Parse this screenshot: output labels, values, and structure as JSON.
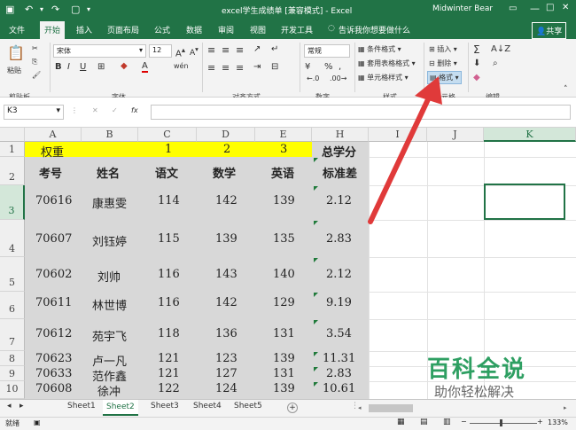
{
  "window": {
    "doc_title": "excel学生成绩单 [兼容模式] - Excel",
    "user": "Midwinter Bear",
    "minimize": "—",
    "restore": "□",
    "close": "✕"
  },
  "tabs": [
    "文件",
    "开始",
    "插入",
    "页面布局",
    "公式",
    "数据",
    "审阅",
    "视图",
    "开发工具"
  ],
  "tell_me": "告诉我你想要做什么",
  "share": "共享",
  "ribbon": {
    "paste": "粘贴",
    "clipboard": "剪贴板",
    "font_name": "宋体",
    "font_size": "12",
    "bold": "B",
    "italic": "I",
    "underline": "U",
    "font_color_glyph": "A",
    "font_group": "字体",
    "wrap": "wén",
    "align_group": "对齐方式",
    "num_format": "常规",
    "percent": "%",
    "comma": ",",
    "number_group": "数字",
    "cond_format": "条件格式",
    "table_format": "套用表格格式",
    "cell_style": "单元格样式",
    "style_group": "样式",
    "insert": "插入",
    "delete": "删除",
    "format": "格式",
    "cells_group": "单元格",
    "sum": "Σ",
    "edit_group": "编辑"
  },
  "formula_bar": {
    "name_box": "K3",
    "cancel": "✕",
    "enter": "✓",
    "fx": "fx",
    "value": ""
  },
  "columns": [
    "A",
    "B",
    "C",
    "D",
    "E",
    "H",
    "I",
    "J",
    "K"
  ],
  "rows": [
    "1",
    "2",
    "3",
    "4",
    "5",
    "6",
    "7",
    "8",
    "9",
    "10"
  ],
  "sheet": {
    "row1": {
      "a": "权重",
      "c": "1",
      "d": "2",
      "e": "3",
      "h": "总学分"
    },
    "headers": {
      "a": "考号",
      "b": "姓名",
      "c": "语文",
      "d": "数学",
      "e": "英语",
      "h": "标准差"
    },
    "data": [
      [
        "70616",
        "康惠雯",
        "114",
        "142",
        "139",
        "2.12"
      ],
      [
        "70607",
        "刘钰婷",
        "115",
        "139",
        "135",
        "2.83"
      ],
      [
        "70602",
        "刘帅",
        "116",
        "143",
        "140",
        "2.12"
      ],
      [
        "70611",
        "林世博",
        "116",
        "142",
        "129",
        "9.19"
      ],
      [
        "70612",
        "苑宇飞",
        "118",
        "136",
        "131",
        "3.54"
      ],
      [
        "70623",
        "卢一凡",
        "121",
        "123",
        "139",
        "11.31"
      ],
      [
        "70633",
        "范作鑫",
        "121",
        "127",
        "131",
        "2.83"
      ],
      [
        "70608",
        "徐冲",
        "122",
        "124",
        "139",
        "10.61"
      ]
    ]
  },
  "sheet_tabs": [
    "Sheet1",
    "Sheet2",
    "Sheet3",
    "Sheet4",
    "Sheet5"
  ],
  "add_sheet": "+",
  "status": {
    "ready": "就绪",
    "zoom": "133%"
  },
  "watermark": {
    "title": "百科全说",
    "subtitle": "助你轻松解决"
  },
  "colors": {
    "excel_green": "#217346",
    "highlight": "#ffff00",
    "arrow": "#e03a3a"
  }
}
